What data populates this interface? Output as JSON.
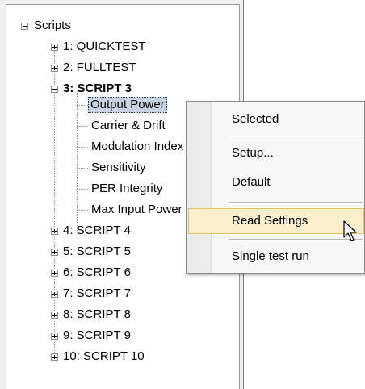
{
  "tree": {
    "root": "Scripts",
    "scripts": [
      {
        "label": "1: QUICKTEST"
      },
      {
        "label": "2: FULLTEST"
      },
      {
        "label": "3: SCRIPT  3",
        "children": [
          "Output Power",
          "Carrier & Drift",
          "Modulation Index",
          "Sensitivity",
          "PER Integrity",
          "Max Input Power"
        ]
      },
      {
        "label": "4: SCRIPT  4"
      },
      {
        "label": "5: SCRIPT  5"
      },
      {
        "label": "6: SCRIPT  6"
      },
      {
        "label": "7: SCRIPT  7"
      },
      {
        "label": "8: SCRIPT  8"
      },
      {
        "label": "9: SCRIPT  9"
      },
      {
        "label": "10: SCRIPT 10"
      }
    ]
  },
  "context_menu": {
    "items": [
      "Selected",
      "Setup...",
      "Default",
      "Read Settings",
      "Single test run"
    ],
    "highlighted": "Read Settings"
  },
  "colors": {
    "selection_bg": "#c7d3e3",
    "menu_hover_bg": "#fbeecb",
    "menu_hover_border": "#e5c365"
  }
}
